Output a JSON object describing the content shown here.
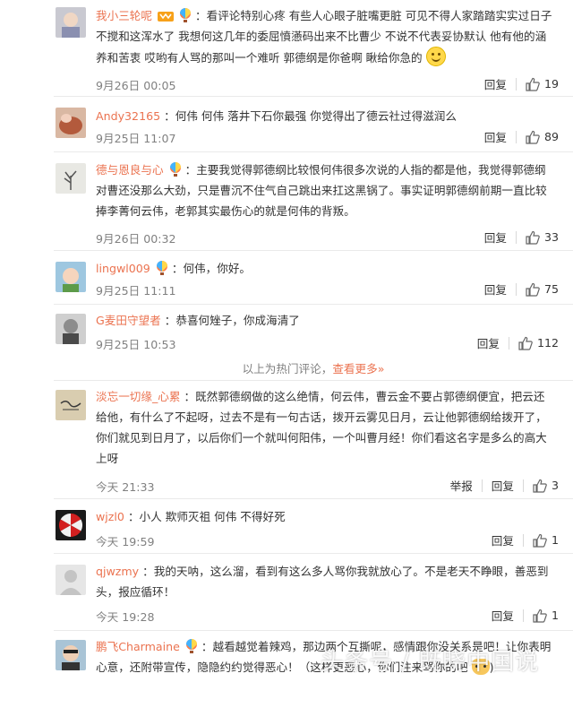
{
  "comments": [
    {
      "username": "我小三轮呢",
      "text": "：看评论特别心疼 有些人心眼子脏嘴更脏 可见不得人家踏踏实实过日子不搅和这浑水了 我想何这几年的委屈憤懣码出来不比曹少 不说不代表妥协默认 他有他的涵养和苦衷 哎哟有人骂的那叫一个难听 郭德纲是你爸啊 瞅给你急的",
      "time": "9月26日 00:05",
      "reply": "回复",
      "likes": "19"
    },
    {
      "username": "Andy32165",
      "text": "：何伟 何伟 落井下石你最强 你觉得出了德云社过得滋润么",
      "time": "9月25日 11:07",
      "reply": "回复",
      "likes": "89"
    },
    {
      "username": "德与恩良与心",
      "text": "：主要我觉得郭德纲比较恨何伟很多次说的人指的都是他，我觉得郭德纲对曹还没那么大劲，只是曹沉不住气自己跳出来扛这黑锅了。事实证明郭德纲前期一直比较捧李菁何云伟，老郭其实最伤心的就是何伟的背叛。",
      "time": "9月26日 00:32",
      "reply": "回复",
      "likes": "33"
    },
    {
      "username": "lingwl009",
      "text": "：何伟，你好。",
      "time": "9月25日 11:11",
      "reply": "回复",
      "likes": "75"
    },
    {
      "username": "G麦田守望者",
      "text": "：恭喜何矬子，你成海清了",
      "time": "9月25日 10:53",
      "reply": "回复",
      "likes": "112"
    },
    {
      "username": "淡忘一切缘_心累",
      "text": "：既然郭德纲做的这么绝情，何云伟，曹云金不要占郭德纲便宜，把云还给他，有什么了不起呀，过去不是有一句古话，拨开云雾见日月，云让他郭德纲给拨开了，你们就见到日月了，以后你们一个就叫何阳伟，一个叫曹月经！你们看这名字是多么的高大上呀",
      "time": "今天 21:33",
      "report": "举报",
      "reply": "回复",
      "likes": "3"
    },
    {
      "username": "wjzl0",
      "text": "：小人 欺师灭祖 何伟 不得好死",
      "time": "今天 19:59",
      "reply": "回复",
      "likes": "1"
    },
    {
      "username": "qjwzmy",
      "text": "：我的天呐，这么溜，看到有这么多人骂你我就放心了。不是老天不睁眼，善恶到头，报应循环！",
      "time": "今天 19:28",
      "reply": "回复",
      "likes": "1"
    },
    {
      "username": "鹏飞Charmaine",
      "text": "：越看越觉着辣鸡，那边两个互撕呢，感情跟你没关系是吧！让你表明心意，还附带宣传，隐隐约约觉得恶心！（这样更恶心，你们注来骂你的吧",
      "tail": ")"
    }
  ],
  "hot_divider": {
    "text": "以上为热门评论，",
    "link": "查看更多»"
  },
  "watermark": "头条号 / 既晓中国说"
}
